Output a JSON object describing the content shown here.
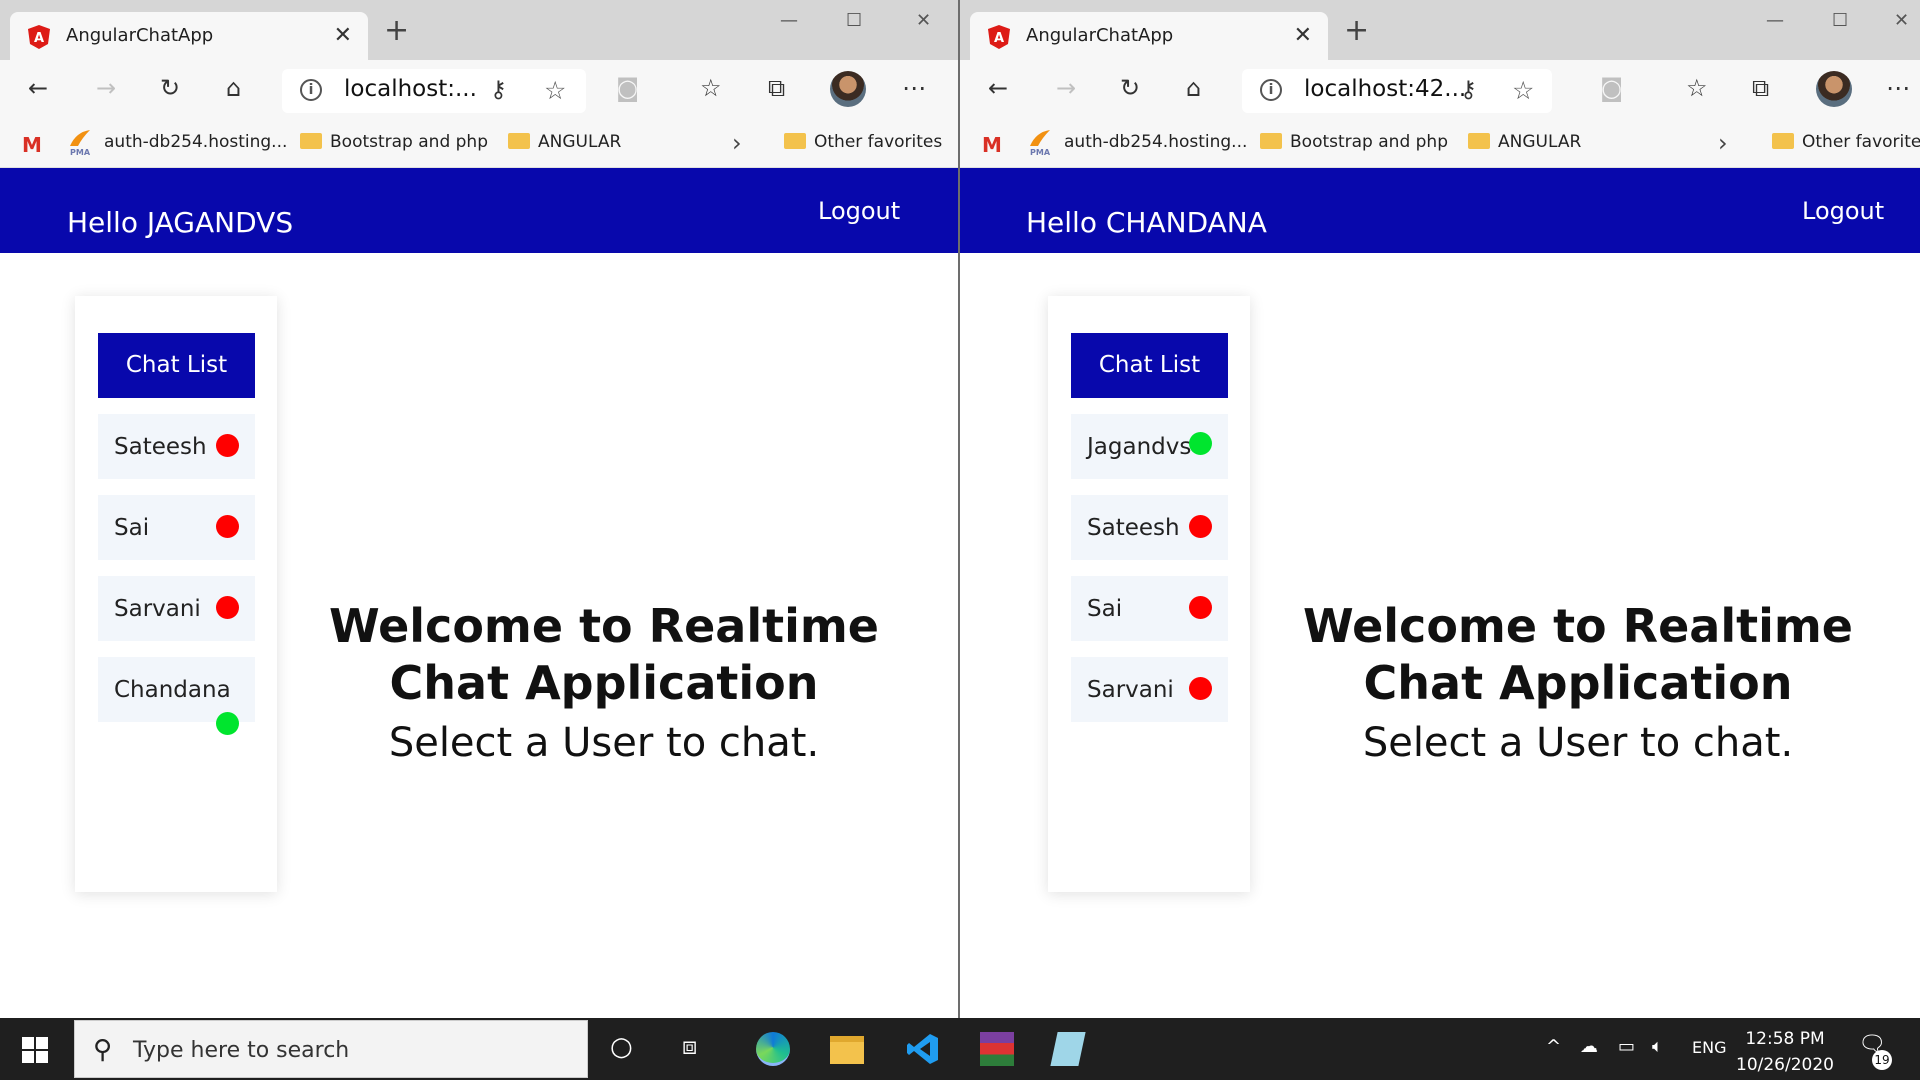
{
  "windows": [
    {
      "tab_title": "AngularChatApp",
      "url": "localhost:...",
      "bookmarks": [
        "auth-db254.hosting...",
        "Bootstrap and php",
        "ANGULAR",
        "Other favorites"
      ],
      "greeting": "Hello JAGANDVS",
      "logout_label": "Logout",
      "chat_list_label": "Chat List",
      "users": [
        {
          "name": "Sateesh",
          "status": "offline"
        },
        {
          "name": "Sai",
          "status": "offline"
        },
        {
          "name": "Sarvani",
          "status": "offline"
        },
        {
          "name": "Chandana",
          "status": "online"
        }
      ],
      "welcome_title": "Welcome to Realtime Chat Application",
      "welcome_subtitle": "Select a User to chat."
    },
    {
      "tab_title": "AngularChatApp",
      "url": "localhost:42...",
      "bookmarks": [
        "auth-db254.hosting...",
        "Bootstrap and php",
        "ANGULAR",
        "Other favorites"
      ],
      "greeting": "Hello CHANDANA",
      "logout_label": "Logout",
      "chat_list_label": "Chat List",
      "users": [
        {
          "name": "Jagandvs",
          "status": "online"
        },
        {
          "name": "Sateesh",
          "status": "offline"
        },
        {
          "name": "Sai",
          "status": "offline"
        },
        {
          "name": "Sarvani",
          "status": "offline"
        }
      ],
      "welcome_title": "Welcome to Realtime Chat Application",
      "welcome_subtitle": "Select a User to chat."
    }
  ],
  "colors": {
    "brand": "#0808ac",
    "online": "#00e52e",
    "offline": "#ff0000"
  },
  "taskbar": {
    "search_placeholder": "Type here to search",
    "language": "ENG",
    "time": "12:58 PM",
    "date": "10/26/2020",
    "notifications": "19"
  }
}
